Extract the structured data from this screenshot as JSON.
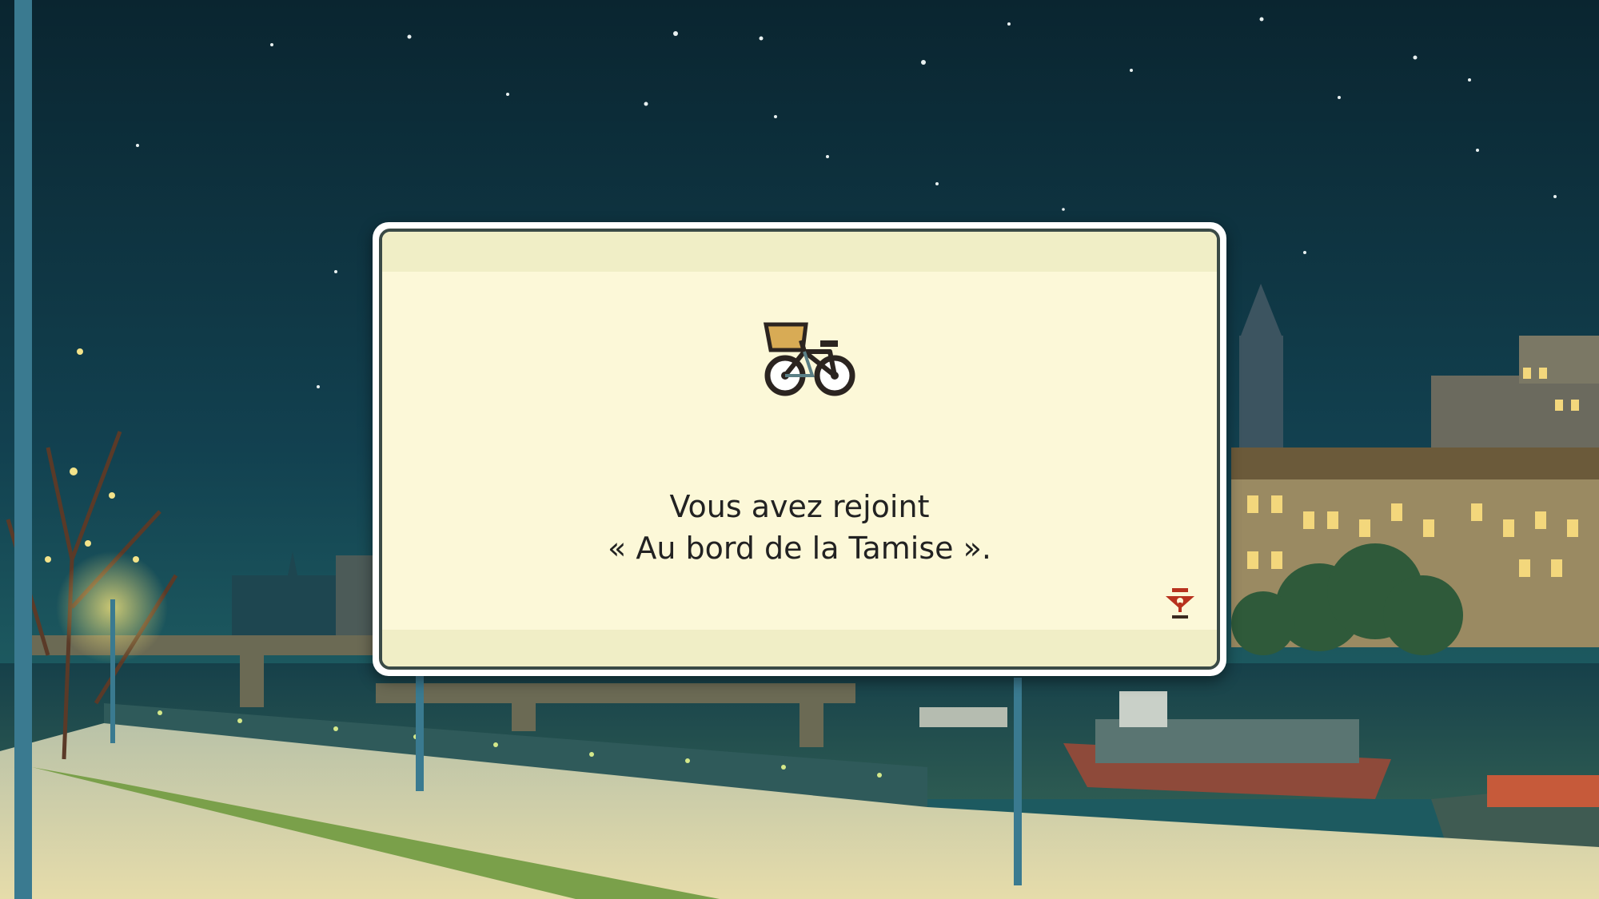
{
  "dialog": {
    "line1": "Vous avez rejoint",
    "line2": "« Au bord de la Tamise »."
  },
  "icons": {
    "item": "bicycle-icon",
    "advance": "next-page-icon"
  },
  "colors": {
    "sky": "#0d2f3c",
    "dialog_bg": "#fcf8d8",
    "dialog_border": "#3a4a46",
    "indicator": "#b8321e"
  }
}
